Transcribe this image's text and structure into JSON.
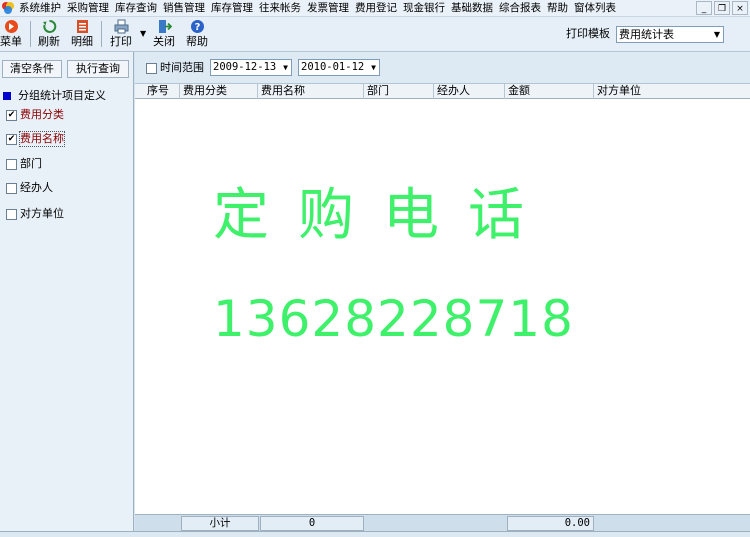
{
  "menu": {
    "items": [
      "系统维护",
      "采购管理",
      "库存查询",
      "销售管理",
      "库存管理",
      "往来帐务",
      "发票管理",
      "费用登记",
      "现金银行",
      "基础数据",
      "综合报表",
      "帮助",
      "窗体列表"
    ]
  },
  "window_controls": {
    "minimize": "_",
    "restore": "❐",
    "close": "×"
  },
  "toolbar": {
    "menu_label": "菜单",
    "refresh_label": "刷新",
    "detail_label": "明细",
    "print_label": "打印",
    "close_label": "关闭",
    "help_label": "帮助",
    "print_template_label": "打印模板",
    "print_template_value": "费用统计表"
  },
  "left_panel": {
    "clear_button": "清空条件",
    "query_button": "执行查询",
    "section_title": "分组统计项目定义",
    "group_items": [
      {
        "label": "费用分类",
        "checked": true
      },
      {
        "label": "费用名称",
        "checked": true
      },
      {
        "label": "部门",
        "checked": false
      },
      {
        "label": "经办人",
        "checked": false
      },
      {
        "label": "对方单位",
        "checked": false
      }
    ]
  },
  "filter": {
    "time_range_label": "时间范围",
    "time_range_checked": false,
    "start_date": "2009-12-13",
    "end_date": "2010-01-12"
  },
  "grid": {
    "columns": [
      "序号",
      "费用分类",
      "费用名称",
      "部门",
      "经办人",
      "金额",
      "对方单位"
    ]
  },
  "watermark": {
    "title": "定购电话",
    "phone": "13628228718",
    "color": "#3ff06a"
  },
  "footer": {
    "subtotal_label": "小计",
    "count": "0",
    "amount": "0.00"
  },
  "colors": {
    "checked_label": "#8b0000",
    "section_marker": "#0000cc"
  }
}
